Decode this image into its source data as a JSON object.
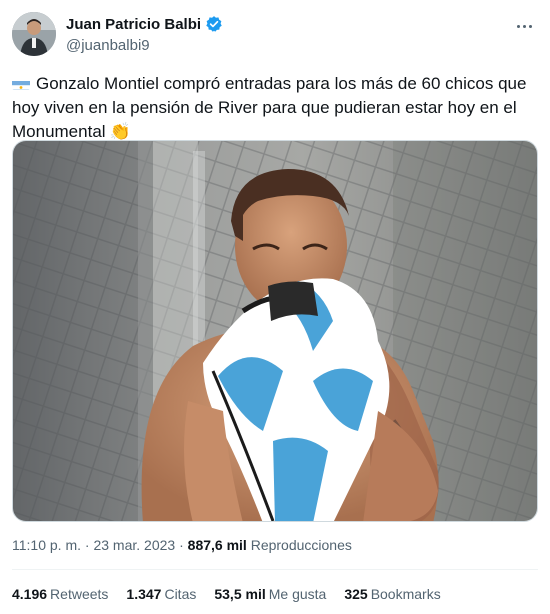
{
  "author": {
    "display_name": "Juan Patricio Balbi",
    "handle": "@juanbalbi9",
    "verified": true
  },
  "tweet": {
    "text": "Gonzalo Montiel compró entradas para los más de 60 chicos que hoy viven en la pensión de River para que pudieran estar hoy en el Monumental",
    "leading_emoji": "argentina-flag-icon",
    "trailing_emoji": "clapping-hands-icon"
  },
  "meta": {
    "time": "11:10 p. m.",
    "separator": "·",
    "date": "23 mar. 2023",
    "views_count": "887,6 mil",
    "views_label": "Reproducciones"
  },
  "stats": {
    "retweets_count": "4.196",
    "retweets_label": "Retweets",
    "quotes_count": "1.347",
    "quotes_label": "Citas",
    "likes_count": "53,5 mil",
    "likes_label": "Me gusta",
    "bookmarks_count": "325",
    "bookmarks_label": "Bookmarks"
  },
  "colors": {
    "verified_blue": "#1d9bf0",
    "secondary_text": "#536471",
    "primary_text": "#0f1419",
    "jersey_blue": "#4aa3d8"
  }
}
